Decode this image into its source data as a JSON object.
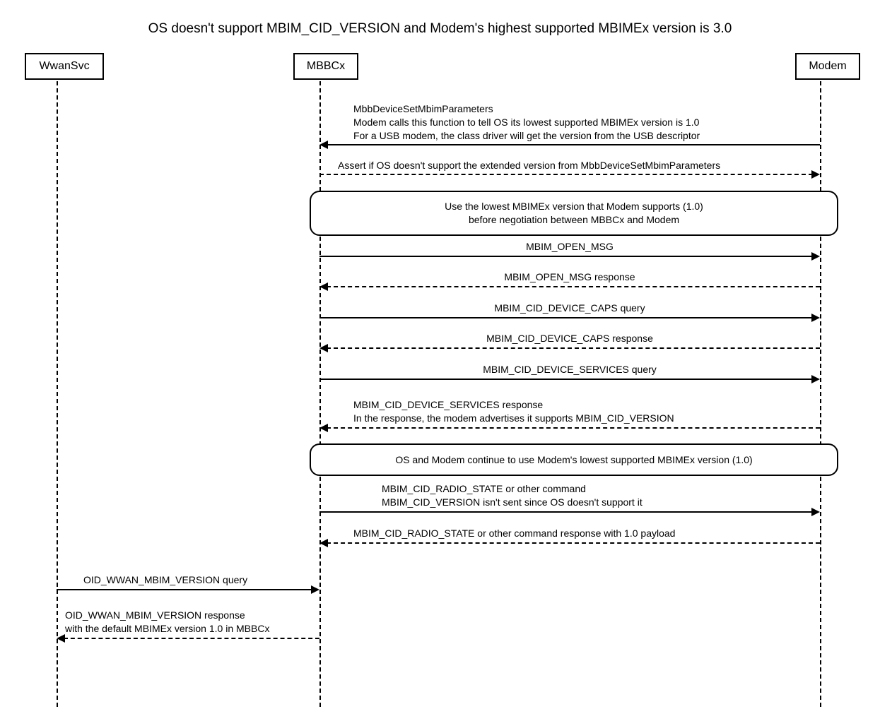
{
  "title": "OS doesn't support MBIM_CID_VERSION and Modem's highest supported MBIMEx version is 3.0",
  "participants": {
    "wwansvc": "WwanSvc",
    "mbbcx": "MBBCx",
    "modem": "Modem"
  },
  "messages": {
    "m1": "MbbDeviceSetMbimParameters\nModem calls this function to tell OS its lowest supported MBIMEx version is 1.0\nFor a USB modem, the class driver will get the version from the USB descriptor",
    "m2": "Assert if OS doesn't support the extended version from MbbDeviceSetMbimParameters",
    "note1": "Use the lowest MBIMEx version that Modem supports (1.0)\nbefore negotiation between MBBCx and Modem",
    "m3": "MBIM_OPEN_MSG",
    "m4": "MBIM_OPEN_MSG response",
    "m5": "MBIM_CID_DEVICE_CAPS query",
    "m6": "MBIM_CID_DEVICE_CAPS response",
    "m7": "MBIM_CID_DEVICE_SERVICES query",
    "m8": "MBIM_CID_DEVICE_SERVICES response\nIn the response, the modem advertises it supports MBIM_CID_VERSION",
    "note2": "OS and Modem continue to use Modem's lowest supported MBIMEx version (1.0)",
    "m9": "MBIM_CID_RADIO_STATE or other command\nMBIM_CID_VERSION isn't sent since OS doesn't support it",
    "m10": "MBIM_CID_RADIO_STATE or other command response with 1.0 payload",
    "m11": "OID_WWAN_MBIM_VERSION query",
    "m12": "OID_WWAN_MBIM_VERSION response\nwith the default MBIMEx version 1.0 in MBBCx"
  }
}
